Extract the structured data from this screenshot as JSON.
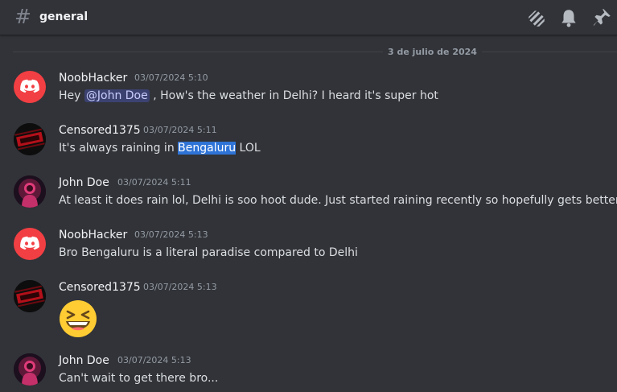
{
  "channel": {
    "name": "general",
    "hash_icon": "#"
  },
  "toolbar": {
    "icons": [
      "threads-icon",
      "bell-icon",
      "pin-icon"
    ]
  },
  "date_divider": "3 de julio de 2024",
  "messages": [
    {
      "author": "NoobHacker",
      "timestamp": "03/07/2024 5:10",
      "pre": "Hey ",
      "mention": "@John Doe",
      "post": " , How's the weather in Delhi? I heard it's super hot",
      "avatar": "discord-logo-avatar"
    },
    {
      "author": "Censored1375",
      "timestamp": "03/07/2024 5:11",
      "pre": "It's always raining in ",
      "highlight": "Bengaluru",
      "post": " LOL",
      "avatar": "censored-avatar"
    },
    {
      "author": "John Doe",
      "timestamp": "03/07/2024 5:11",
      "text": "At least it does rain lol, Delhi is soo hoot dude. Just started raining recently so hopefully gets better",
      "avatar": "john-doe-avatar"
    },
    {
      "author": "NoobHacker",
      "timestamp": "03/07/2024 5:13",
      "text": "Bro Bengaluru is a literal paradise compared to Delhi",
      "avatar": "discord-logo-avatar"
    },
    {
      "author": "Censored1375",
      "timestamp": "03/07/2024 5:13",
      "emoji": "laughing-emoji",
      "avatar": "censored-avatar"
    },
    {
      "author": "John Doe",
      "timestamp": "03/07/2024 5:13",
      "text": "Can't wait to get there bro...",
      "avatar": "john-doe-avatar"
    }
  ],
  "colors": {
    "background": "#313338",
    "discord_red": "#f23f43",
    "mention_bg": "#3c4270",
    "highlight": "#2e73d6"
  }
}
